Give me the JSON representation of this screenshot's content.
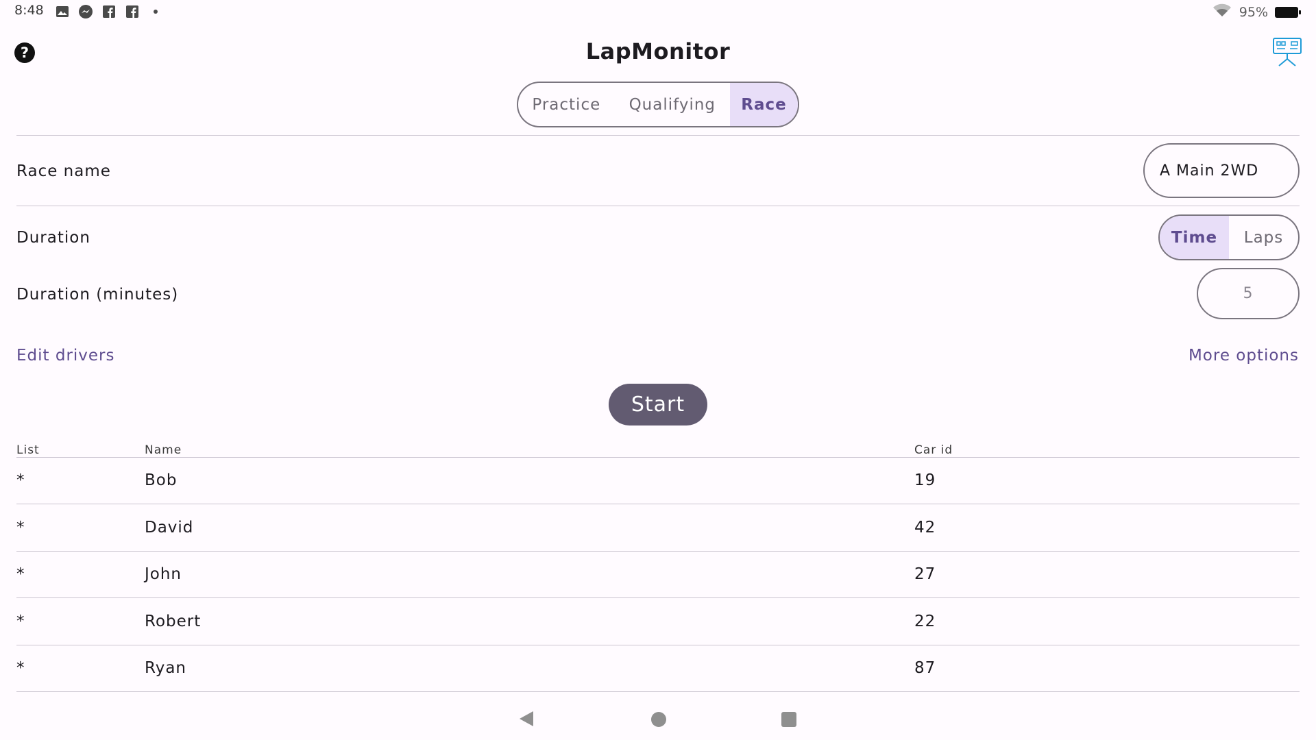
{
  "status_bar": {
    "time": "8:48",
    "icons": [
      "gallery-icon",
      "messenger-icon",
      "facebook-icon",
      "facebook-icon",
      "dot-icon"
    ],
    "battery": "95%"
  },
  "app": {
    "title": "LapMonitor"
  },
  "mode_tabs": [
    {
      "label": "Practice",
      "active": false
    },
    {
      "label": "Qualifying",
      "active": false
    },
    {
      "label": "Race",
      "active": true
    }
  ],
  "race_name": {
    "label": "Race name",
    "value": "A Main 2WD"
  },
  "duration": {
    "label": "Duration",
    "options": [
      {
        "label": "Time",
        "active": true
      },
      {
        "label": "Laps",
        "active": false
      }
    ]
  },
  "duration_minutes": {
    "label": "Duration (minutes)",
    "value": "5"
  },
  "links": {
    "edit_drivers": "Edit drivers",
    "more_options": "More options"
  },
  "start_label": "Start",
  "table": {
    "headers": [
      "List",
      "Name",
      "Car id"
    ],
    "rows": [
      {
        "list": "*",
        "name": "Bob",
        "car_id": "19"
      },
      {
        "list": "*",
        "name": "David",
        "car_id": "42"
      },
      {
        "list": "*",
        "name": "John",
        "car_id": "27"
      },
      {
        "list": "*",
        "name": "Robert",
        "car_id": "22"
      },
      {
        "list": "*",
        "name": "Ryan",
        "car_id": "87"
      }
    ]
  },
  "colors": {
    "accent": "#5e4c8f",
    "selected_bg": "#e8def8",
    "button": "#625b71",
    "outline": "#7a757f"
  }
}
